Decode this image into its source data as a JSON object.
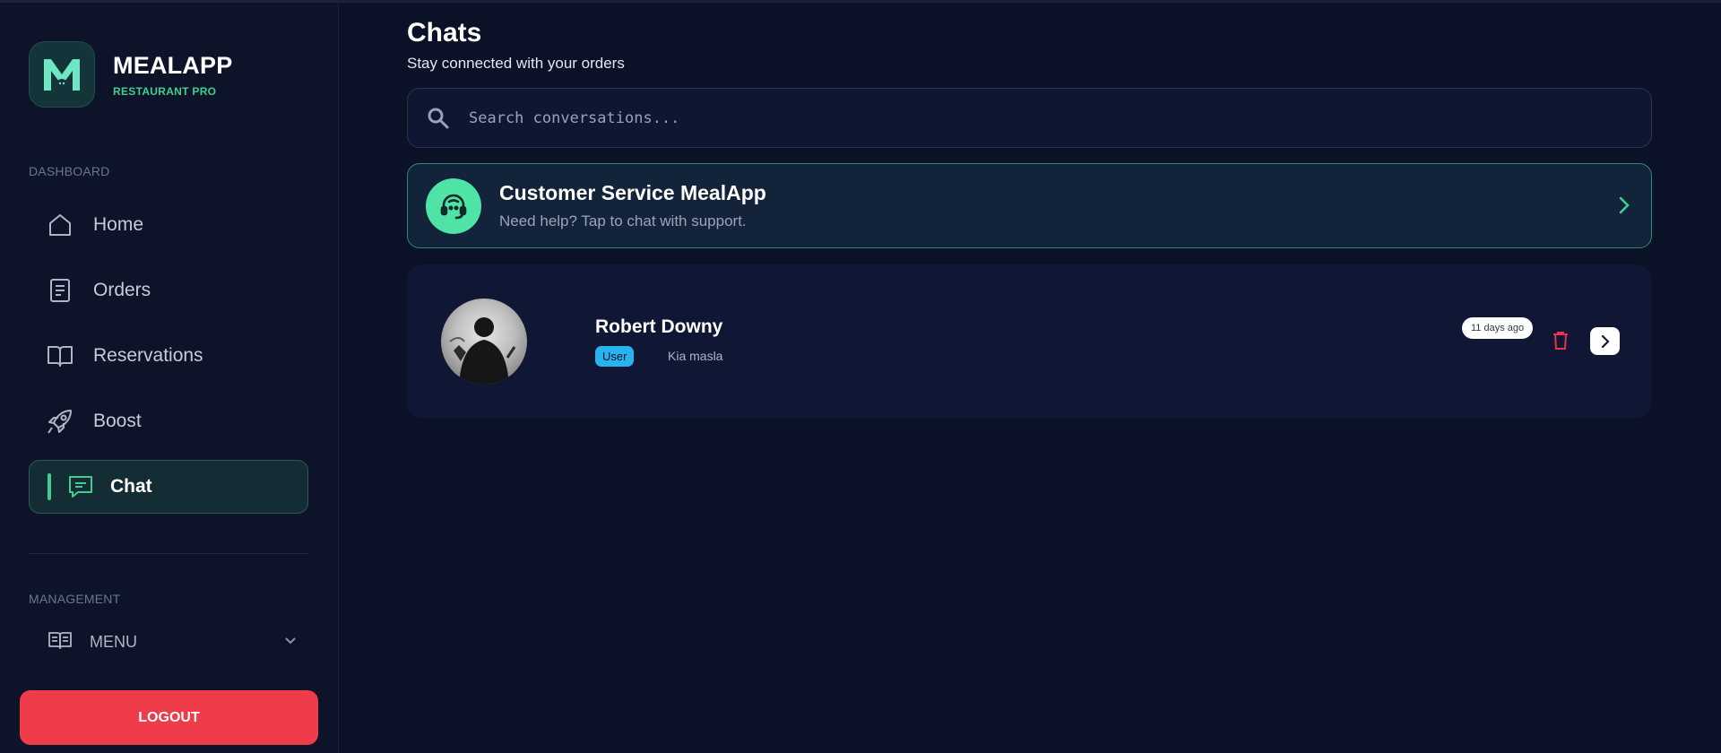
{
  "brand": {
    "name": "MEALAPP",
    "subtitle": "RESTAURANT PRO",
    "logo_letter": "M"
  },
  "sidebar": {
    "dashboard_label": "DASHBOARD",
    "items": [
      {
        "label": "Home",
        "icon": "home-icon"
      },
      {
        "label": "Orders",
        "icon": "orders-icon"
      },
      {
        "label": "Reservations",
        "icon": "book-icon"
      },
      {
        "label": "Boost",
        "icon": "rocket-icon"
      },
      {
        "label": "Chat",
        "icon": "chat-icon",
        "active": true
      }
    ],
    "management_label": "MANAGEMENT",
    "menu": {
      "label": "MENU",
      "icon": "menu-book-icon"
    },
    "logout_label": "LOGOUT"
  },
  "main": {
    "title": "Chats",
    "subtitle": "Stay connected with your orders",
    "search": {
      "placeholder": "Search conversations..."
    },
    "support": {
      "title": "Customer Service MealApp",
      "subtitle": "Need help? Tap to chat with support."
    },
    "chats": [
      {
        "name": "Robert Downy",
        "role": "User",
        "preview": "Kia masla",
        "time": "11 days ago"
      }
    ]
  },
  "colors": {
    "background": "#0b1127",
    "accent": "#3ecf8e",
    "logout": "#ef3b4a",
    "badge": "#27b3ee"
  }
}
